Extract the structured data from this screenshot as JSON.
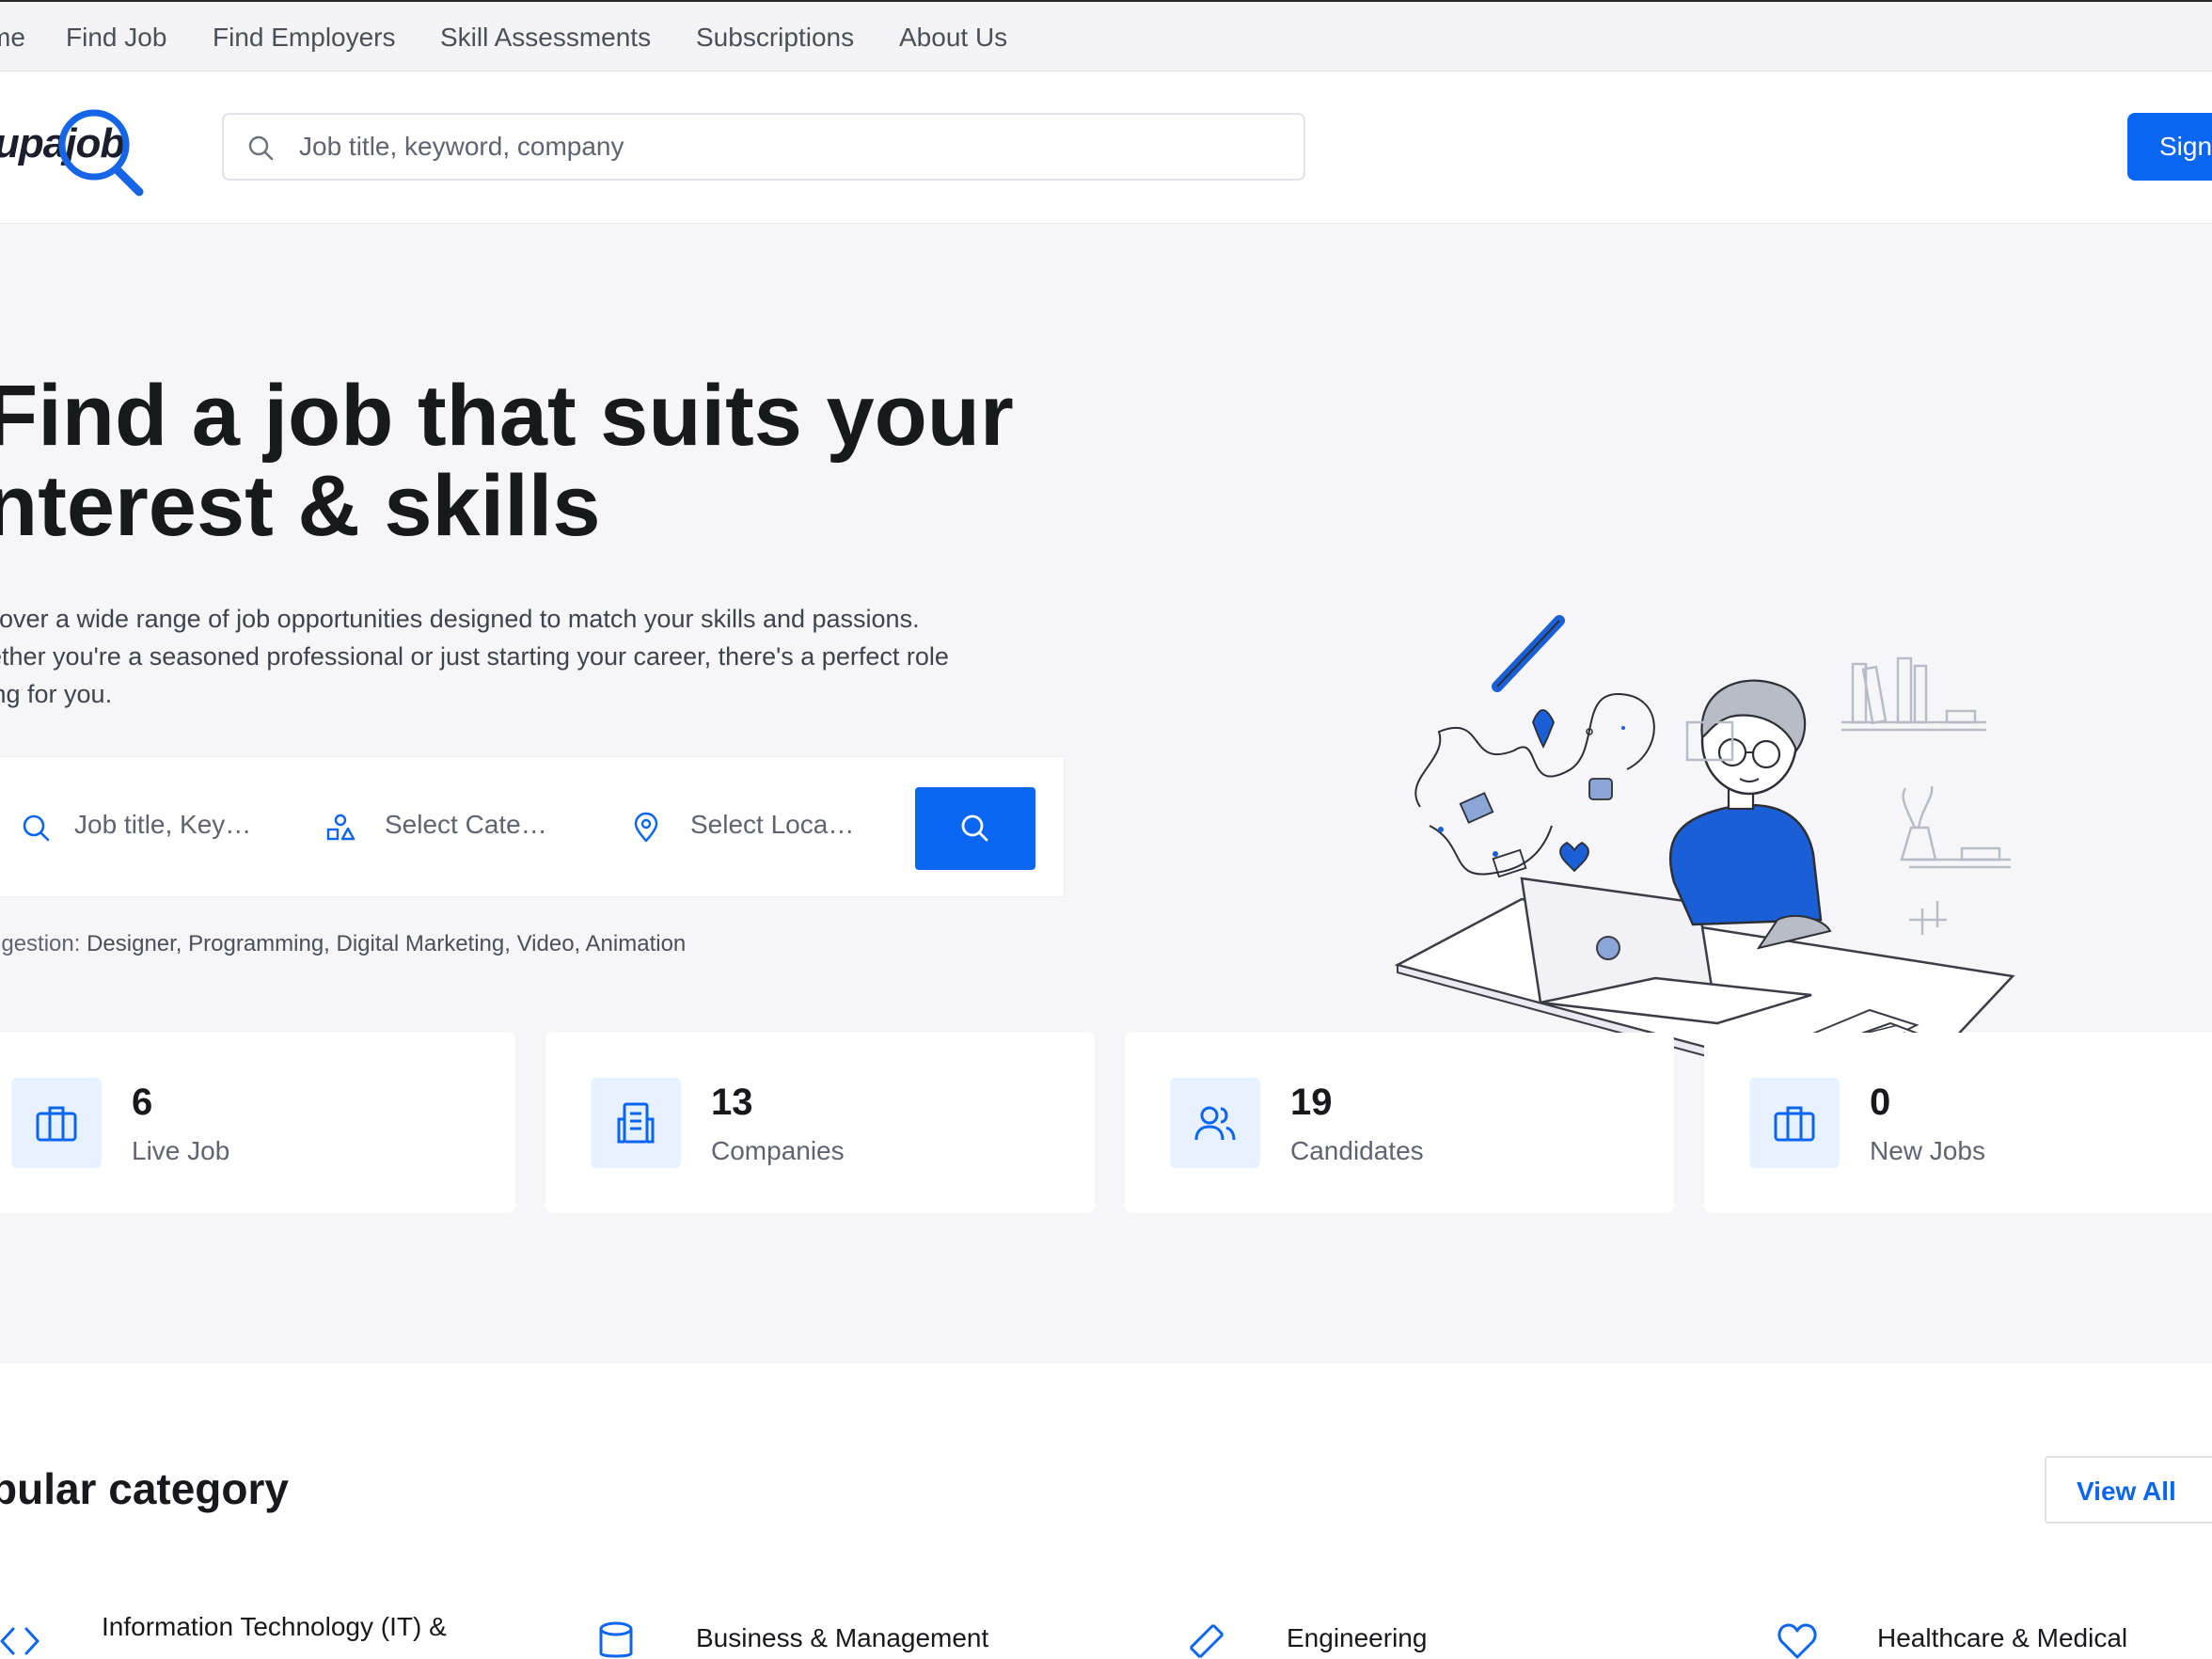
{
  "topnav": {
    "items": [
      "me",
      "Find Job",
      "Find Employers",
      "Skill Assessments",
      "Subscriptions",
      "About Us"
    ]
  },
  "header": {
    "logo_text": "upajob",
    "search_placeholder": "Job title, keyword, company",
    "signin_label": "Sign"
  },
  "hero": {
    "title_line1": "Find a job that suits your",
    "title_line2": "nterest & skills",
    "desc_line1": "scover a wide range of job opportunities designed to match your skills and passions.",
    "desc_line2": "hether you're a seasoned professional or just starting your career, there's a perfect role",
    "desc_line3": "iting for you.",
    "search": {
      "keyword_placeholder": "Job title, Key…",
      "category_placeholder": "Select Cate…",
      "location_placeholder": "Select Loca…"
    },
    "suggestion_label": "ggestion:",
    "suggestion_values": "Designer, Programming, Digital Marketing, Video, Animation"
  },
  "stats": [
    {
      "value": "6",
      "label": "Live Job",
      "icon": "briefcase-icon"
    },
    {
      "value": "13",
      "label": "Companies",
      "icon": "building-icon"
    },
    {
      "value": "19",
      "label": "Candidates",
      "icon": "users-icon"
    },
    {
      "value": "0",
      "label": "New Jobs",
      "icon": "briefcase-icon"
    }
  ],
  "popular": {
    "title": "pular category",
    "view_all_label": "View All",
    "categories": [
      {
        "label": "Information Technology (IT) &",
        "icon": "code-icon"
      },
      {
        "label": "Business & Management",
        "icon": "database-icon"
      },
      {
        "label": "Engineering",
        "icon": "tools-icon"
      },
      {
        "label": "Healthcare & Medical",
        "icon": "heart-icon"
      }
    ]
  },
  "colors": {
    "accent": "#0a65f0",
    "hero_bg": "#f6f6f9",
    "icon_bg": "#e8f1ff",
    "text_dark": "#18191c",
    "text_muted": "#5f6470"
  }
}
